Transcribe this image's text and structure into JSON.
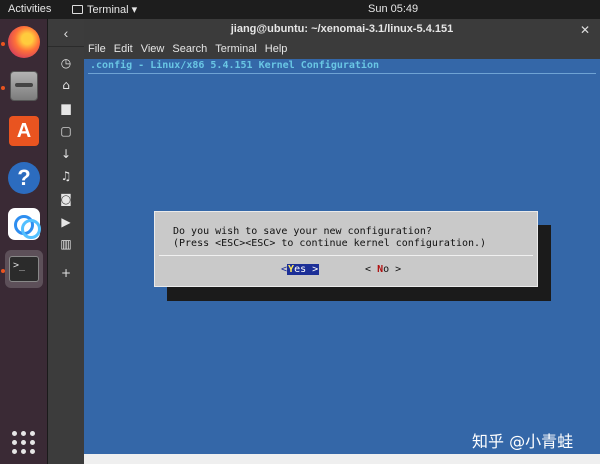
{
  "topbar": {
    "activities": "Activities",
    "app_name": "Terminal ▾",
    "clock": "Sun 05:49"
  },
  "dock": {
    "items": [
      {
        "name": "firefox",
        "icon": "firefox-icon"
      },
      {
        "name": "files",
        "icon": "files-icon"
      },
      {
        "name": "software",
        "icon": "software-center-icon",
        "glyph": "A"
      },
      {
        "name": "help",
        "icon": "help-icon",
        "glyph": "?"
      },
      {
        "name": "baidu-netdisk",
        "icon": "cloud-icon"
      },
      {
        "name": "terminal",
        "icon": "terminal-icon",
        "glyph": ">_"
      }
    ]
  },
  "sidebar": {
    "back": "‹",
    "icons": [
      "recent-icon",
      "home-icon",
      "folder-icon",
      "document-icon",
      "download-icon",
      "music-icon",
      "camera-icon",
      "video-icon",
      "trash-icon",
      "plus-icon"
    ],
    "glyphs": [
      "◷",
      "⌂",
      "▆",
      "▢",
      "↓",
      "♫",
      "◙",
      "▶",
      "▥",
      "+"
    ]
  },
  "window": {
    "title": "jiang@ubuntu: ~/xenomai-3.1/linux-5.4.151",
    "close": "✕",
    "menu": [
      "File",
      "Edit",
      "View",
      "Search",
      "Terminal",
      "Help"
    ]
  },
  "terminal": {
    "header": ".config - Linux/x86 5.4.151 Kernel Configuration",
    "dialog": {
      "line1": "Do you wish to save your new configuration?",
      "line2": "(Press <ESC><ESC> to continue kernel configuration.)",
      "yes": {
        "lbracket": "<",
        "key": "Y",
        "rest": "es",
        "rbracket": ">"
      },
      "no": {
        "lbracket": "<",
        "key": "N",
        "rest": "o",
        "rbracket": ">"
      }
    }
  },
  "watermark": "知乎 @小青蛙",
  "colors": {
    "terminal_bg": "#3467a8",
    "header_text": "#69c6e4",
    "dialog_bg": "#c9c9c9",
    "button_highlight": "#1c2f97",
    "hotkey_yes": "#ffea5c",
    "hotkey_no": "#b01010"
  }
}
